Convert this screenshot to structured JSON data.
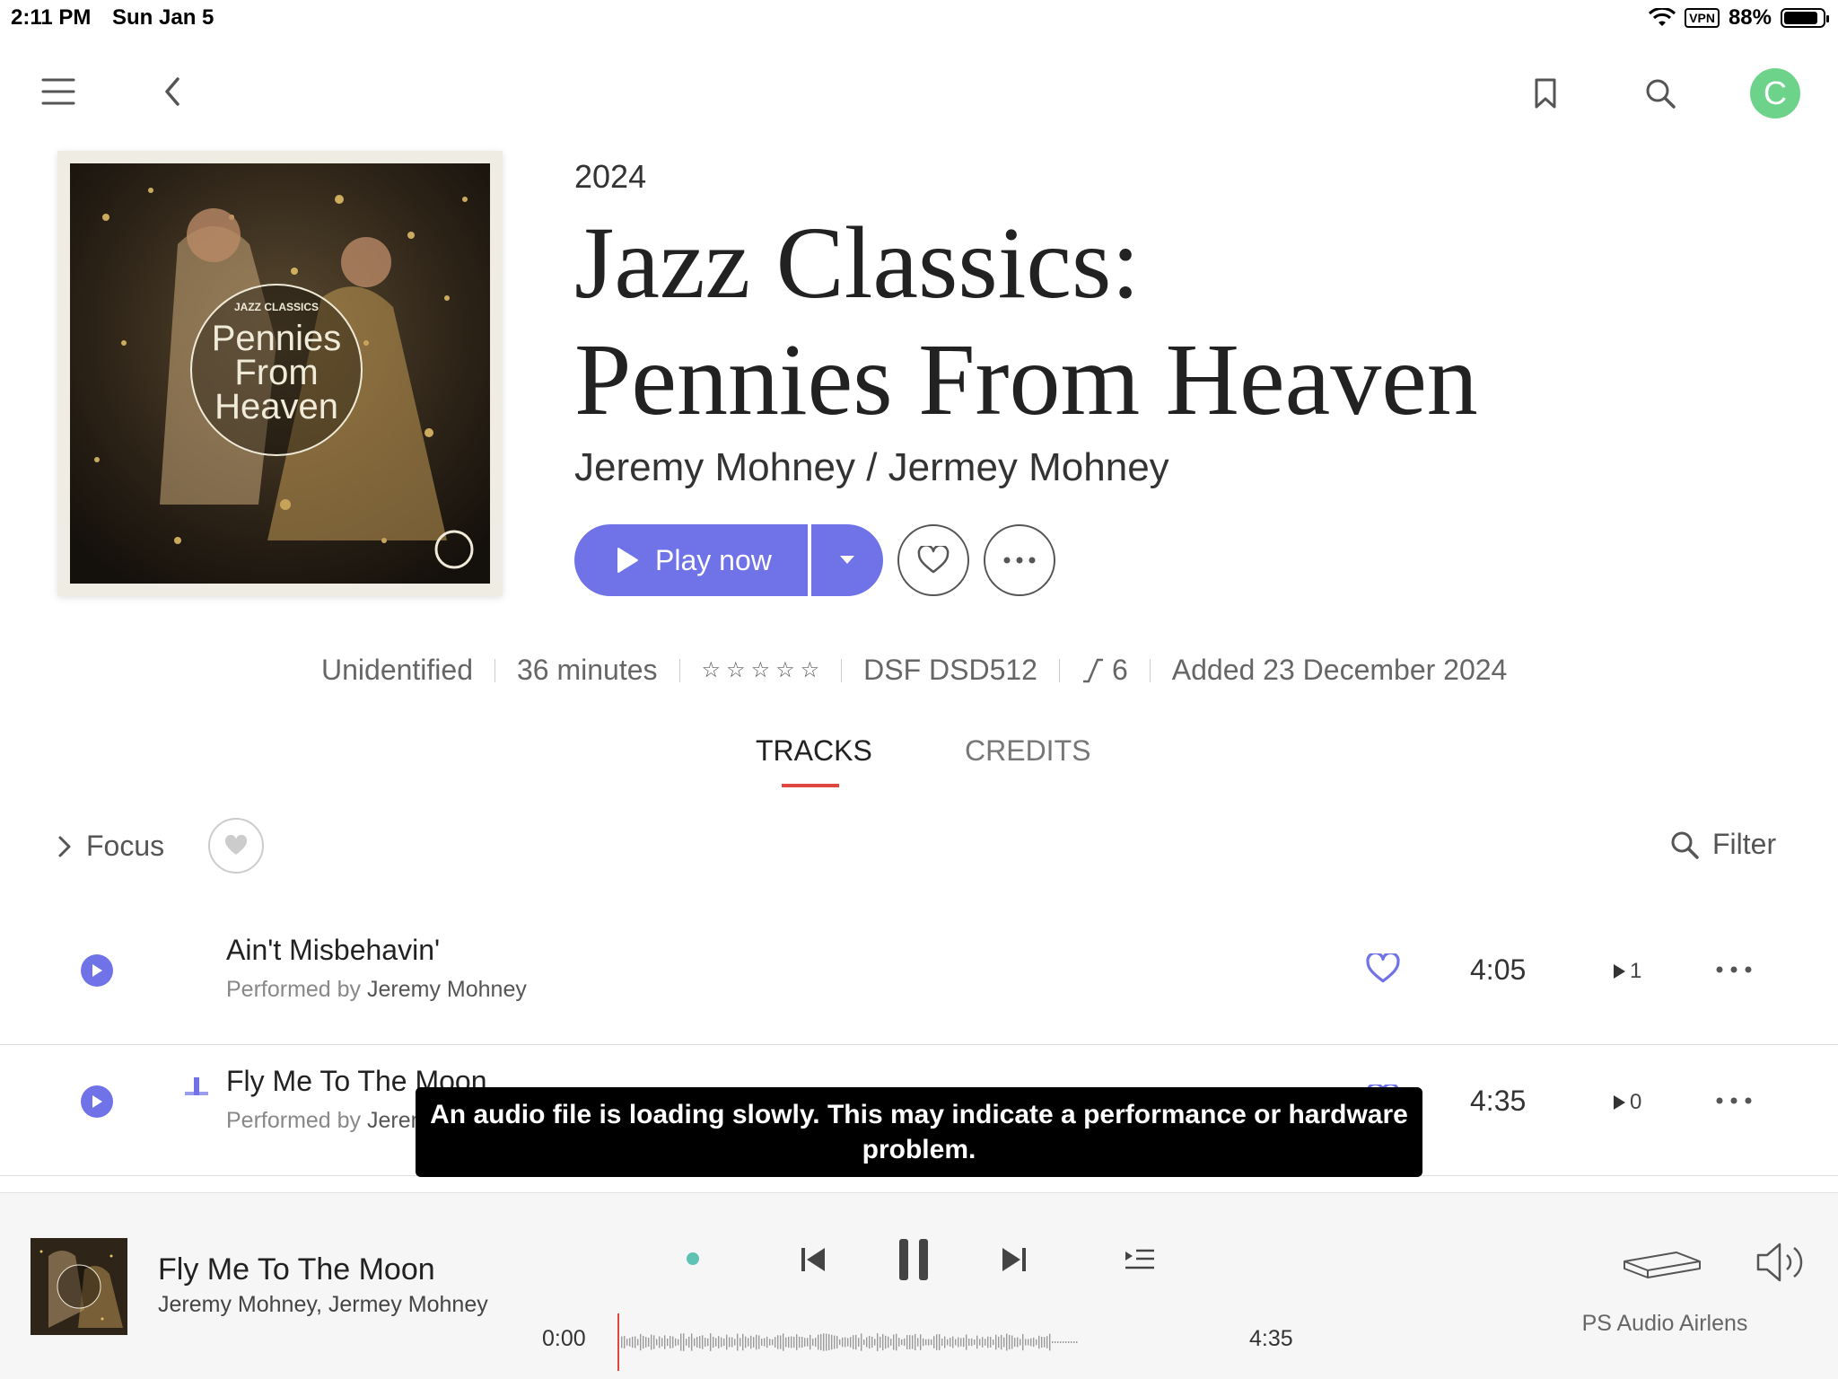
{
  "status": {
    "time": "2:11 PM",
    "date": "Sun Jan 5",
    "vpn": "VPN",
    "battery": "88%"
  },
  "header": {
    "avatar_letter": "C"
  },
  "album": {
    "cover_text": {
      "series": "JAZZ CLASSICS",
      "line1": "Pennies",
      "line2": "From",
      "line3": "Heaven"
    },
    "year": "2024",
    "title_line1": "Jazz Classics:",
    "title_line2": "Pennies From Heaven",
    "artist": "Jeremy Mohney / Jermey Mohney"
  },
  "actions": {
    "play_label": "Play now"
  },
  "meta": {
    "status": "Unidentified",
    "duration": "36 minutes",
    "rating": 0,
    "format": "DSF DSD512",
    "versions": "6",
    "added": "Added 23 December 2024"
  },
  "tabs": {
    "tracks": "TRACKS",
    "credits": "CREDITS"
  },
  "toolbar": {
    "focus": "Focus",
    "filter": "Filter"
  },
  "tracks": [
    {
      "title": "Ain't Misbehavin'",
      "performed_prefix": "Performed by ",
      "performer": "Jeremy Mohney",
      "duration": "4:05",
      "plays": "1"
    },
    {
      "title": "Fly Me To The Moon",
      "performed_prefix": "Performed by ",
      "performer": "Jeremy Mohney",
      "duration": "4:35",
      "plays": "0"
    }
  ],
  "toast": {
    "message": "An audio file is loading slowly. This may indicate a performance or hardware problem."
  },
  "player": {
    "title": "Fly Me To The Moon",
    "artist": "Jeremy Mohney, Jermey Mohney",
    "elapsed": "0:00",
    "total": "4:35",
    "progress": 0,
    "zone": "PS Audio Airlens"
  },
  "colors": {
    "accent": "#7073e8",
    "tab_indicator": "#e0473f",
    "avatar": "#6dd38a"
  }
}
